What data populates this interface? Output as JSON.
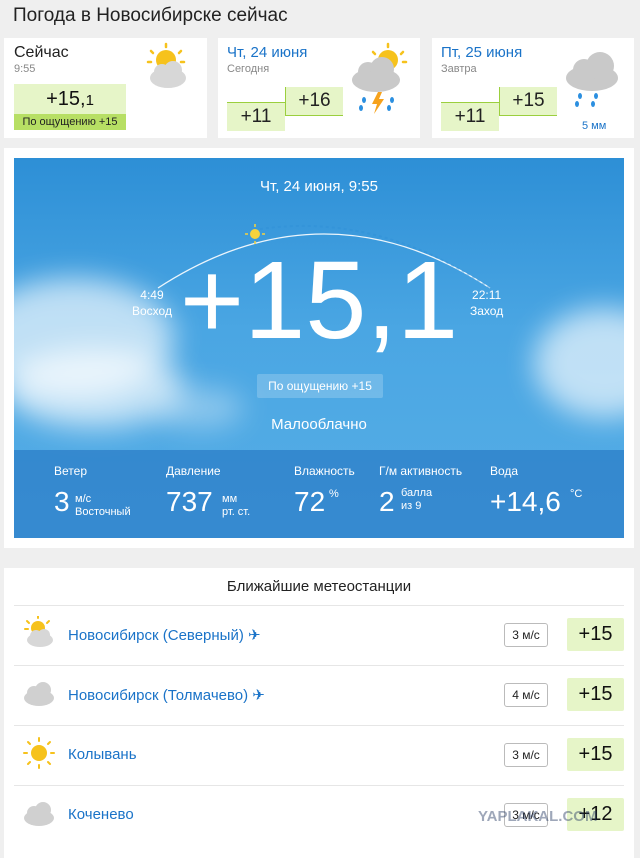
{
  "page_title": "Погода в Новосибирске сейчас",
  "now": {
    "label": "Сейчас",
    "time": "9:55",
    "temp_main": "+15,",
    "temp_decimal": "1",
    "feels": "По ощущению +15",
    "icon": "partly-cloudy-icon"
  },
  "days": [
    {
      "title": "Чт, 24 июня",
      "sub": "Сегодня",
      "tmin": "+11",
      "tmax": "+16",
      "precip": "",
      "icon": "thunderstorm-icon"
    },
    {
      "title": "Пт, 25 июня",
      "sub": "Завтра",
      "tmin": "+11",
      "tmax": "+15",
      "precip": "5 мм",
      "icon": "rain-icon"
    }
  ],
  "main": {
    "date": "Чт, 24 июня, 9:55",
    "temp": "+15,1",
    "sunrise_time": "4:49",
    "sunrise_label": "Восход",
    "sunset_time": "22:11",
    "sunset_label": "Заход",
    "feels": "По ощущению +15",
    "condition": "Малооблачно",
    "stats": {
      "wind_label": "Ветер",
      "wind_value": "3",
      "wind_unit": "м/с",
      "wind_dir": "Восточный",
      "pressure_label": "Давление",
      "pressure_value": "737",
      "pressure_unit1": "мм",
      "pressure_unit2": "рт. ст.",
      "humidity_label": "Влажность",
      "humidity_value": "72",
      "humidity_unit": "%",
      "geomag_label": "Г/м активность",
      "geomag_value": "2",
      "geomag_unit1": "балла",
      "geomag_unit2": "из 9",
      "water_label": "Вода",
      "water_value": "+14,6",
      "water_unit": "°C"
    }
  },
  "stations": {
    "title": "Ближайшие метеостанции",
    "items": [
      {
        "name": "Новосибирск (Северный)",
        "airport": "✈",
        "wind": "3 м/с",
        "temp": "+15",
        "icon": "partly-cloudy-icon"
      },
      {
        "name": "Новосибирск (Толмачево)",
        "airport": "✈",
        "wind": "4 м/с",
        "temp": "+15",
        "icon": "cloudy-icon"
      },
      {
        "name": "Колывань",
        "airport": "",
        "wind": "3 м/с",
        "temp": "+15",
        "icon": "sun-icon"
      },
      {
        "name": "Коченево",
        "airport": "",
        "wind": "3 м/с",
        "temp": "+12",
        "icon": "cloudy-icon"
      }
    ]
  },
  "watermark": "YAPLAKAL.COM",
  "colors": {
    "link": "#1a73c8",
    "temp_bg": "#e6f5c8",
    "feel_bg": "#b7df64",
    "sky": "#3a9ade"
  }
}
